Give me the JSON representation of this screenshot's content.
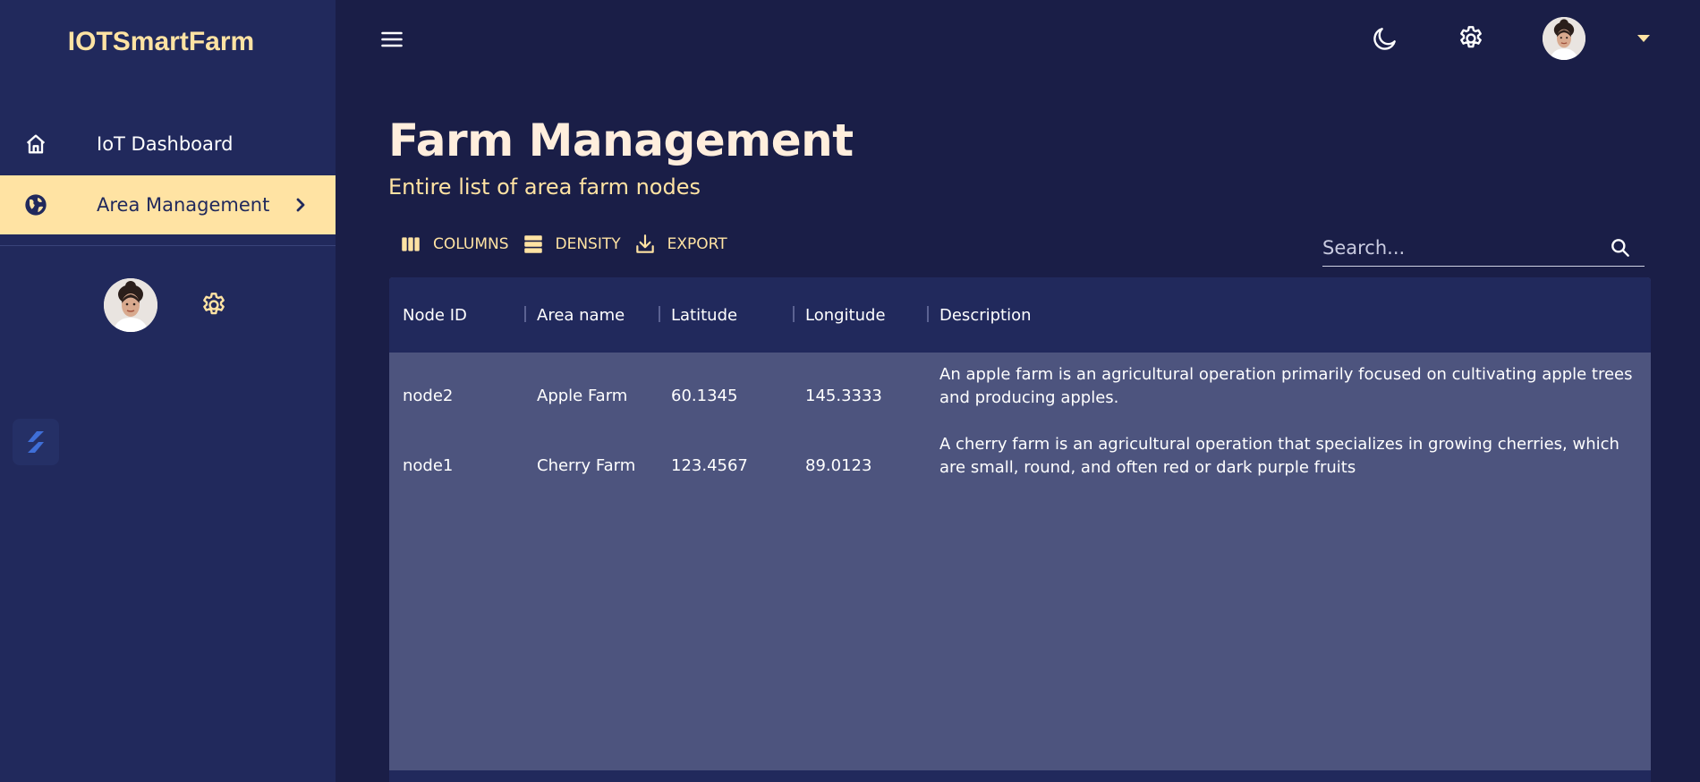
{
  "app": {
    "title": "IOTSmartFarm"
  },
  "sidebar": {
    "items": [
      {
        "label": "IoT Dashboard",
        "icon": "home-icon"
      },
      {
        "label": "Area Management",
        "icon": "globe-icon"
      }
    ]
  },
  "page": {
    "title": "Farm Management",
    "subtitle": "Entire list of area farm nodes"
  },
  "toolbar": {
    "columns_label": "COLUMNS",
    "density_label": "DENSITY",
    "export_label": "EXPORT"
  },
  "search": {
    "placeholder": "Search..."
  },
  "table": {
    "columns": [
      "Node ID",
      "Area name",
      "Latitude",
      "Longitude",
      "Description"
    ],
    "rows": [
      {
        "node_id": "node2",
        "area_name": "Apple Farm",
        "latitude": "60.1345",
        "longitude": "145.3333",
        "description": "An apple farm is an agricultural operation primarily focused on cultivating apple trees and producing apples."
      },
      {
        "node_id": "node1",
        "area_name": "Cherry Farm",
        "latitude": "123.4567",
        "longitude": "89.0123",
        "description": "A cherry farm is an agricultural operation that specializes in growing cherries, which are small, round, and often red or dark purple fruits"
      }
    ]
  },
  "colors": {
    "sidebar_bg": "#21295c",
    "main_bg": "#1a1e47",
    "accent": "#ffe3a3",
    "grid_body": "#4d547e"
  }
}
